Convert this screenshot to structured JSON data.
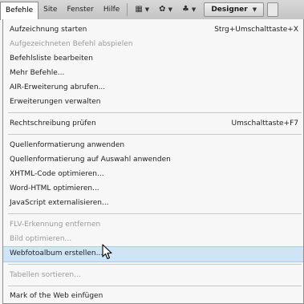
{
  "menubar": {
    "befehle": "Befehle",
    "site": "Site",
    "fenster": "Fenster",
    "hilfe": "Hilfe",
    "designer": "Designer"
  },
  "menu": {
    "items": [
      {
        "label": "Aufzeichnung starten",
        "shortcut": "Strg+Umschalttaste+X",
        "disabled": false
      },
      {
        "label": "Aufgezeichneten Befehl abspielen",
        "shortcut": "",
        "disabled": true
      },
      {
        "label": "Befehlsliste bearbeiten",
        "shortcut": "",
        "disabled": false
      },
      {
        "label": "Mehr Befehle...",
        "shortcut": "",
        "disabled": false
      },
      {
        "label": "AIR-Erweiterung abrufen...",
        "shortcut": "",
        "disabled": false
      },
      {
        "label": "Erweiterungen verwalten",
        "shortcut": "",
        "disabled": false
      },
      {
        "label": "Rechtschreibung prüfen",
        "shortcut": "Umschalttaste+F7",
        "disabled": false
      },
      {
        "label": "Quellenformatierung anwenden",
        "shortcut": "",
        "disabled": false
      },
      {
        "label": "Quellenformatierung auf Auswahl anwenden",
        "shortcut": "",
        "disabled": false
      },
      {
        "label": "XHTML-Code optimieren...",
        "shortcut": "",
        "disabled": false
      },
      {
        "label": "Word-HTML optimieren...",
        "shortcut": "",
        "disabled": false
      },
      {
        "label": "JavaScript externalisieren...",
        "shortcut": "",
        "disabled": false
      },
      {
        "label": "FLV-Erkennung entfernen",
        "shortcut": "",
        "disabled": true
      },
      {
        "label": "Bild optimieren...",
        "shortcut": "",
        "disabled": true
      },
      {
        "label": "Webfotoalbum erstellen......",
        "shortcut": "",
        "disabled": false,
        "hover": true
      },
      {
        "label": "Tabellen sortieren...",
        "shortcut": "",
        "disabled": true
      },
      {
        "label": "Mark of the Web einfügen",
        "shortcut": "",
        "disabled": false
      }
    ]
  },
  "colors": {
    "hover_bg": "#cfe4f7",
    "disabled_text": "#9a9a9a"
  }
}
